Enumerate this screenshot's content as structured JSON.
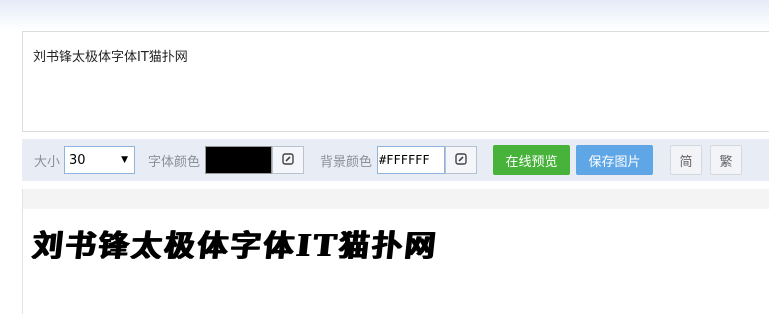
{
  "input": {
    "text": "刘书锋太极体字体IT猫扑网"
  },
  "toolbar": {
    "size_label": "大小",
    "size_value": "30",
    "font_color_label": "字体颜色",
    "font_color": "#000000",
    "bg_color_label": "背景颜色",
    "bg_color_value": "#FFFFFF",
    "preview_button": "在线预览",
    "save_button": "保存图片",
    "simplified_button": "简",
    "traditional_button": "繁"
  },
  "preview": {
    "text": "刘书锋太极体字体IT猫扑网"
  },
  "colors": {
    "preview_btn": "#48b33a",
    "save_btn": "#5fa6e6",
    "toolbar_bg": "#e8edf5"
  },
  "icons": [
    "chevron-down-icon",
    "color-picker-icon"
  ]
}
